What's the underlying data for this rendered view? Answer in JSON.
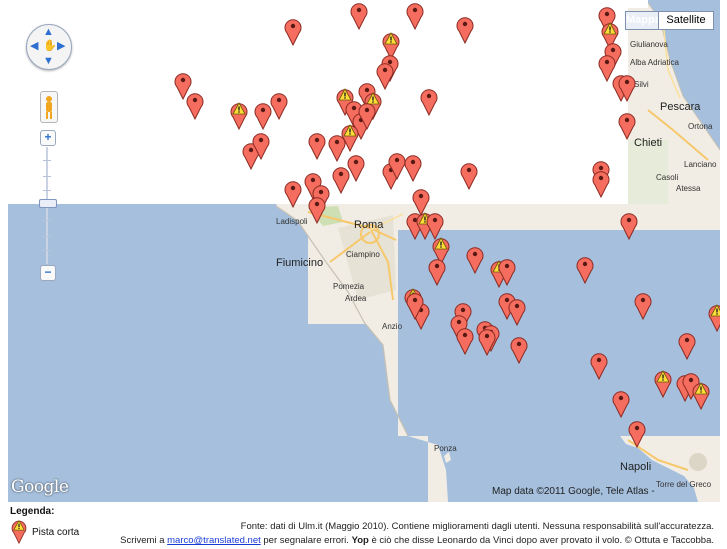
{
  "map": {
    "type_buttons": [
      {
        "label": "Mappa",
        "selected": true
      },
      {
        "label": "Satellite",
        "selected": false
      }
    ],
    "places": [
      {
        "label": "Roma",
        "big": true
      },
      {
        "label": "Ciampino",
        "big": false
      },
      {
        "label": "Ladispoli",
        "big": false
      },
      {
        "label": "Fiumicino",
        "big": true
      },
      {
        "label": "Pomezia",
        "big": false
      },
      {
        "label": "Ardea",
        "big": false
      },
      {
        "label": "Anzio",
        "big": false
      },
      {
        "label": "Pescara",
        "big": true
      },
      {
        "label": "Chieti",
        "big": true
      },
      {
        "label": "Ortona",
        "big": false
      },
      {
        "label": "Lanciano",
        "big": false
      },
      {
        "label": "Casoli",
        "big": false
      },
      {
        "label": "Atessa",
        "big": false
      },
      {
        "label": "Silvi",
        "big": false
      },
      {
        "label": "Napoli",
        "big": true
      },
      {
        "label": "Ponza",
        "big": false
      },
      {
        "label": "Torre del Greco",
        "big": false
      },
      {
        "label": "Giulianova",
        "big": false
      },
      {
        "label": "Alba Adriatica",
        "big": false
      }
    ],
    "attribution": "Map data ©2011 Google, Tele Atlas -",
    "logo": "Google"
  },
  "legend": {
    "title": "Legenda:",
    "items": [
      {
        "label": "Pista corta",
        "icon": "warning-marker-icon"
      }
    ]
  },
  "footer": {
    "source": "Fonte: dati di Ulm.it (Maggio 2010). Contiene miglioramenti dagli utenti. Nessuna responsabilità sull'accuratezza.",
    "contact_prefix": "Scrivemi a",
    "email": "marco@translated.net",
    "contact_suffix": "per segnalare errori.",
    "yop_label": "Yop",
    "yop_text": "è ciò che disse Leonardo da Vinci dopo aver provato il volo. © Ottuta e Taccobba."
  },
  "colors": {
    "water": "#a5bfdd",
    "land": "#f1ede4",
    "park": "#cddfb3",
    "marker": "#f56d5f",
    "warning": "#ffde3a"
  },
  "markers": [
    {
      "warn": false
    },
    {
      "warn": false
    },
    {
      "warn": false
    },
    {
      "warn": false
    },
    {
      "warn": true
    },
    {
      "warn": false
    },
    {
      "warn": false
    },
    {
      "warn": true
    },
    {
      "warn": false
    },
    {
      "warn": false
    },
    {
      "warn": false
    },
    {
      "warn": false
    },
    {
      "warn": true
    },
    {
      "warn": false
    },
    {
      "warn": false
    },
    {
      "warn": true
    },
    {
      "warn": false
    },
    {
      "warn": false
    },
    {
      "warn": true
    },
    {
      "warn": false
    },
    {
      "warn": false
    },
    {
      "warn": false
    },
    {
      "warn": false
    },
    {
      "warn": false
    },
    {
      "warn": false
    },
    {
      "warn": true
    },
    {
      "warn": false
    },
    {
      "warn": false
    },
    {
      "warn": false
    },
    {
      "warn": false
    },
    {
      "warn": false
    },
    {
      "warn": false
    },
    {
      "warn": false
    },
    {
      "warn": false
    },
    {
      "warn": false
    },
    {
      "warn": false
    },
    {
      "warn": false
    },
    {
      "warn": false
    },
    {
      "warn": false
    },
    {
      "warn": false
    },
    {
      "warn": false
    },
    {
      "warn": false
    },
    {
      "warn": true
    },
    {
      "warn": false
    },
    {
      "warn": true
    },
    {
      "warn": false
    },
    {
      "warn": false
    },
    {
      "warn": true
    },
    {
      "warn": false
    },
    {
      "warn": false
    },
    {
      "warn": false
    },
    {
      "warn": true
    },
    {
      "warn": false
    },
    {
      "warn": false
    },
    {
      "warn": false
    },
    {
      "warn": false
    },
    {
      "warn": false
    },
    {
      "warn": false
    },
    {
      "warn": false
    },
    {
      "warn": false
    },
    {
      "warn": false
    },
    {
      "warn": false
    },
    {
      "warn": false
    },
    {
      "warn": true
    },
    {
      "warn": true
    },
    {
      "warn": false
    },
    {
      "warn": false
    },
    {
      "warn": true
    },
    {
      "warn": false
    },
    {
      "warn": false
    },
    {
      "warn": false
    },
    {
      "warn": false
    },
    {
      "warn": false
    },
    {
      "warn": false
    },
    {
      "warn": false
    },
    {
      "warn": false
    }
  ]
}
